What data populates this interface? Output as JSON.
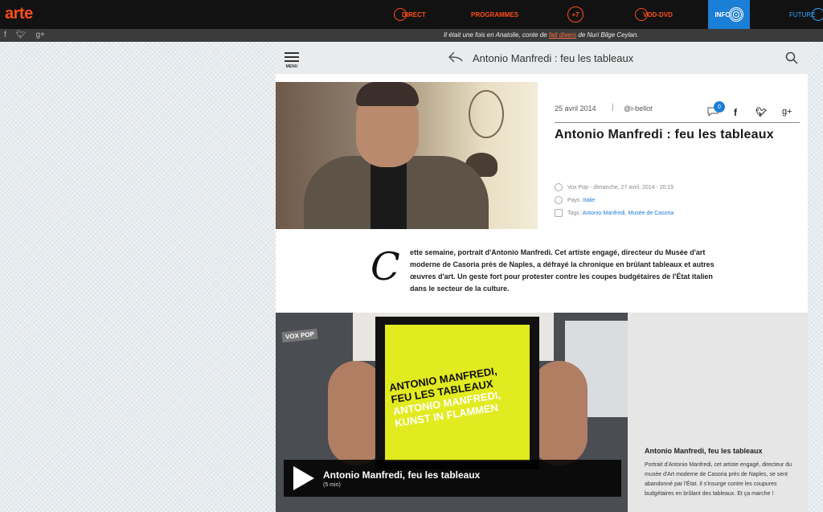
{
  "topbar": {
    "logo": "arte",
    "nav": [
      {
        "label": "DIRECT"
      },
      {
        "label": "PROGRAMMES"
      },
      {
        "label": "+7"
      },
      {
        "label": "VOD-DVD"
      },
      {
        "label": "INFO"
      },
      {
        "label": "FUTURE"
      }
    ],
    "brand_color": "#ff4d1a",
    "info_color": "#1c7fd6"
  },
  "subbar": {
    "ticker_prefix": "Il était une fois en Anatolie, conte de ",
    "ticker_link": "fait divers",
    "ticker_suffix": " de Nuri Bilge Ceylan."
  },
  "header": {
    "menu_label": "MENU",
    "title": "Antonio Manfredi : feu les tableaux"
  },
  "article": {
    "date": "25 avril 2014",
    "separator": "|",
    "author": "@i-bellot",
    "comment_count": "0",
    "title": "Antonio Manfredi : feu les tableaux",
    "meta": {
      "broadcast": "Vox Pop - dimanche, 27 avril, 2014 - 20:15",
      "country_label": "Pays : ",
      "country": "Italie",
      "tags_label": "Tags : ",
      "tags": "Antonio Manfredi, Musée de Casoria"
    },
    "dropcap": "C",
    "intro": "ette semaine, portrait d'Antonio Manfredi. Cet artiste engagé, directeur du Musée d'art moderne de Casoria près de Naples, a défrayé la chronique en brûlant tableaux et autres œuvres d'art. Un geste fort pour protester contre les coupes budgétaires de l'État italien dans le secteur de la culture."
  },
  "video": {
    "badge": "VOX POP",
    "poster_line1": "ANTONIO MANFREDI,",
    "poster_line2": "FEU LES TABLEAUX",
    "poster_line3": "ANTONIO MANFREDI,",
    "poster_line4": "KUNST IN FLAMMEN",
    "title": "Antonio Manfredi, feu les tableaux",
    "duration": "(5 min)",
    "side_title": "Antonio Manfredi, feu les tableaux",
    "side_text": "Portrait d'Antonio Manfredi, cet artiste engagé, directeur du musée d'Art moderne de Casoria près de Naples, se sent abandonné par l'État. Il s'insurge contre les coupures budgétaires en brûlant des tableaux. Et ça marche !"
  }
}
